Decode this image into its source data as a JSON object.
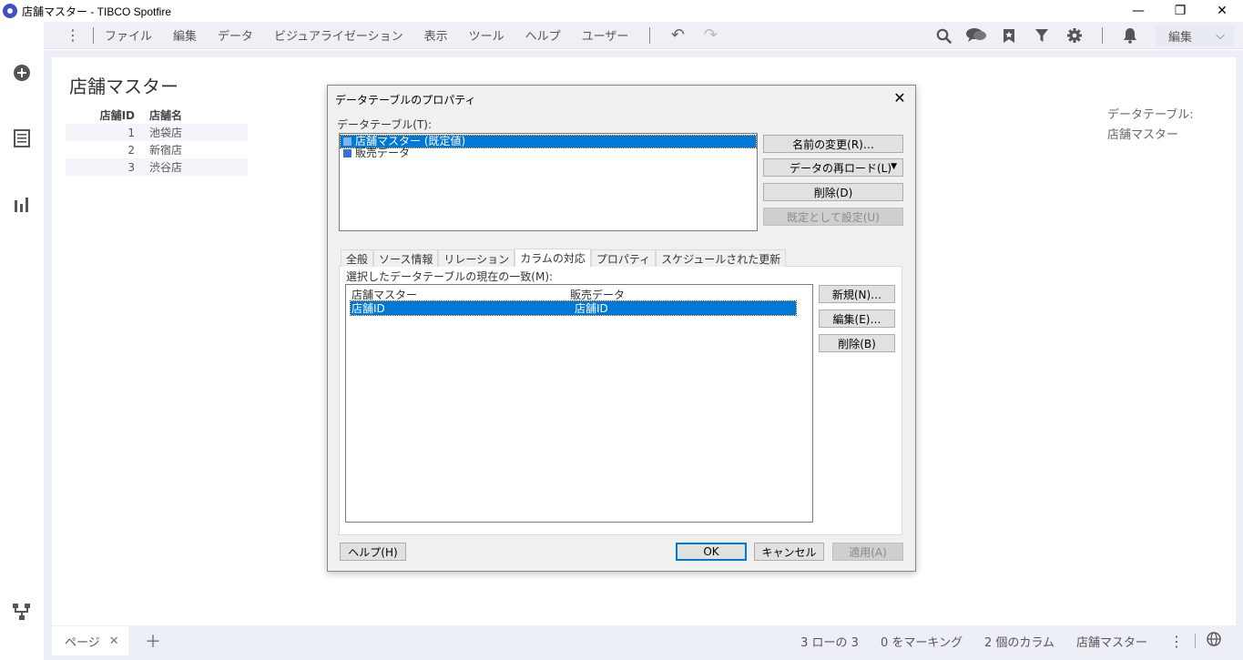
{
  "window": {
    "title": "店舗マスター - TIBCO Spotfire",
    "minimize": "—",
    "restore": "❐",
    "close": "✕"
  },
  "menubar": {
    "kebab": "⋮",
    "items": [
      "ファイル",
      "編集",
      "データ",
      "ビジュアライゼーション",
      "表示",
      "ツール",
      "ヘルプ",
      "ユーザー"
    ],
    "undo_glyph": "↶",
    "redo_glyph": "↷",
    "mode": "編集",
    "mode_caret": "⌵",
    "icons": [
      "search-icon",
      "chat-icon",
      "bookmark-icon",
      "filter-icon",
      "gear-icon",
      "bell-icon"
    ]
  },
  "leftrail": {
    "icons": [
      "add-circle-icon",
      "data-panel-icon",
      "bar-chart-icon",
      "data-canvas-icon"
    ]
  },
  "visualization": {
    "title": "店舗マスター",
    "columns": [
      "店舗ID",
      "店舗名"
    ],
    "rows": [
      {
        "id": "1",
        "name": "池袋店"
      },
      {
        "id": "2",
        "name": "新宿店"
      },
      {
        "id": "3",
        "name": "渋谷店"
      }
    ],
    "side_label": "データテーブル:",
    "side_value": "店舗マスター"
  },
  "bottombar": {
    "page_tab": "ページ",
    "page_close": "✕",
    "add_page": "＋",
    "status_rows": "3 ローの 3",
    "status_marked": "0 をマーキング",
    "status_columns": "2 個のカラム",
    "status_table": "店舗マスター",
    "kebab": "⋮"
  },
  "dialog": {
    "title": "データテーブルのプロパティ",
    "close": "✕",
    "tables_label": "データテーブル(T):",
    "tables": [
      {
        "name": "店舗マスター (既定値)",
        "selected": true
      },
      {
        "name": "販売データ",
        "selected": false
      }
    ],
    "rename_button": "名前の変更(R)…",
    "reload_button": "データの再ロード(L)",
    "reload_caret": "▼",
    "delete_button": "削除(D)",
    "set_default_button": "既定として設定(U)",
    "tabs": [
      "全般",
      "ソース情報",
      "リレーション",
      "カラムの対応",
      "プロパティ",
      "スケジュールされた更新"
    ],
    "active_tab": "カラムの対応",
    "match_label": "選択したデータテーブルの現在の一致(M):",
    "match_columns": [
      "店舗マスター",
      "販売データ"
    ],
    "match_rows": [
      {
        "left": "店舗ID",
        "right": "店舗ID",
        "selected": true
      }
    ],
    "new_button": "新規(N)…",
    "edit_button": "編集(E)…",
    "remove_button": "削除(B)",
    "help_button": "ヘルプ(H)",
    "ok_button": "OK",
    "cancel_button": "キャンセル",
    "apply_button": "適用(A)"
  }
}
